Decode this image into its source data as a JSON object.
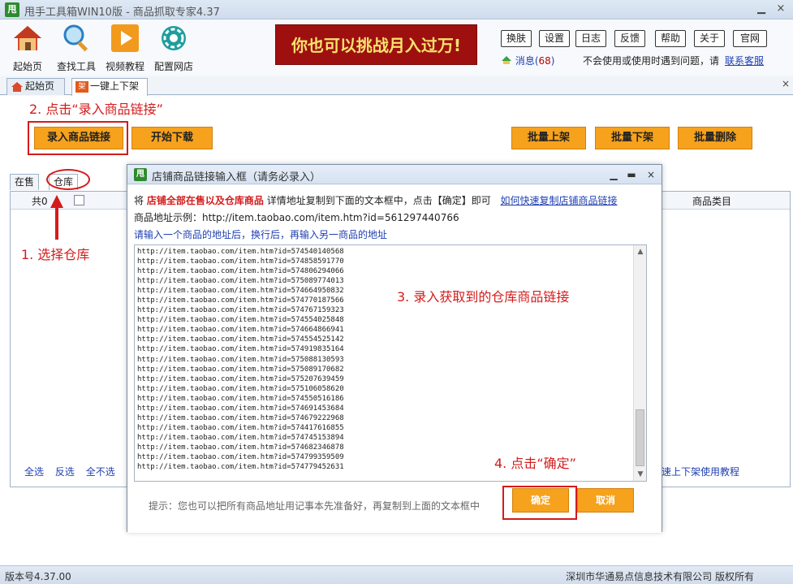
{
  "window": {
    "logo_char": "甩",
    "title": "甩手工具箱WIN10版 - 商品抓取专家4.37",
    "minimize": "▁",
    "close": "×"
  },
  "toolbar": {
    "items": [
      {
        "label": "起始页",
        "icon": "house-icon"
      },
      {
        "label": "查找工具",
        "icon": "magnifier-icon"
      },
      {
        "label": "视频教程",
        "icon": "play-icon"
      },
      {
        "label": "配置网店",
        "icon": "gear-icon"
      }
    ],
    "banner": "你也可以挑战月入过万!",
    "buttons": [
      "换肤",
      "设置",
      "日志",
      "反馈",
      "帮助",
      "关于",
      "官网"
    ],
    "message_label": "消息(",
    "message_count": "68",
    "message_close": ")",
    "help_text": "不会使用或使用时遇到问题，请",
    "help_link": "联系客服"
  },
  "tabs": {
    "items": [
      "起始页",
      "一键上下架"
    ],
    "close": "×"
  },
  "main": {
    "step2": "2. 点击“录入商品链接”",
    "btn_record_links": "录入商品链接",
    "btn_start_download": "开始下载",
    "btn_batch_up": "批量上架",
    "btn_batch_down": "批量下架",
    "btn_batch_delete": "批量删除",
    "subtabs": [
      "在售",
      "仓库"
    ],
    "step1": "1. 选择仓库",
    "table_header_count": "共0",
    "table_header_category": "商品类目",
    "select_all": "全选",
    "select_invert": "反选",
    "select_none": "全不选",
    "tutorial_link": "速上下架使用教程"
  },
  "statusbar": {
    "version": "版本号4.37.00",
    "copyright": "深圳市华通易点信息技术有限公司 版权所有"
  },
  "dialog": {
    "title": "店铺商品链接输入框（请务必录入）",
    "minimize": "▁",
    "maximize": "▬",
    "close": "×",
    "line1_a": "将",
    "line1_red": "店铺全部在售以及仓库商品",
    "line1_b": "详情地址复制到下面的文本框中，点击【确定】即可",
    "line1_link": "如何快速复制店铺商品链接",
    "line2": "商品地址示例：http://item.taobao.com/item.htm?id=561297440766",
    "line3": "请输入一个商品的地址后，换行后，再输入另一商品的地址",
    "step3": "3. 录入获取到的仓库商品链接",
    "step4": "4. 点击“确定”",
    "urls": "http://item.taobao.com/item.htm?id=574540140568\nhttp://item.taobao.com/item.htm?id=574858591770\nhttp://item.taobao.com/item.htm?id=574806294066\nhttp://item.taobao.com/item.htm?id=575089774013\nhttp://item.taobao.com/item.htm?id=574664950832\nhttp://item.taobao.com/item.htm?id=574770187566\nhttp://item.taobao.com/item.htm?id=574767159323\nhttp://item.taobao.com/item.htm?id=574554025848\nhttp://item.taobao.com/item.htm?id=574664866941\nhttp://item.taobao.com/item.htm?id=574554525142\nhttp://item.taobao.com/item.htm?id=574919835164\nhttp://item.taobao.com/item.htm?id=575088130593\nhttp://item.taobao.com/item.htm?id=575089170682\nhttp://item.taobao.com/item.htm?id=575207639459\nhttp://item.taobao.com/item.htm?id=575106058620\nhttp://item.taobao.com/item.htm?id=574550516186\nhttp://item.taobao.com/item.htm?id=574691453684\nhttp://item.taobao.com/item.htm?id=574679222968\nhttp://item.taobao.com/item.htm?id=574417616855\nhttp://item.taobao.com/item.htm?id=574745153894\nhttp://item.taobao.com/item.htm?id=574682346878\nhttp://item.taobao.com/item.htm?id=574799359509\nhttp://item.taobao.com/item.htm?id=574779452631",
    "hint": "提示：您也可以把所有商品地址用记事本先准备好，再复制到上面的文本框中",
    "ok": "确定",
    "cancel": "取消"
  }
}
